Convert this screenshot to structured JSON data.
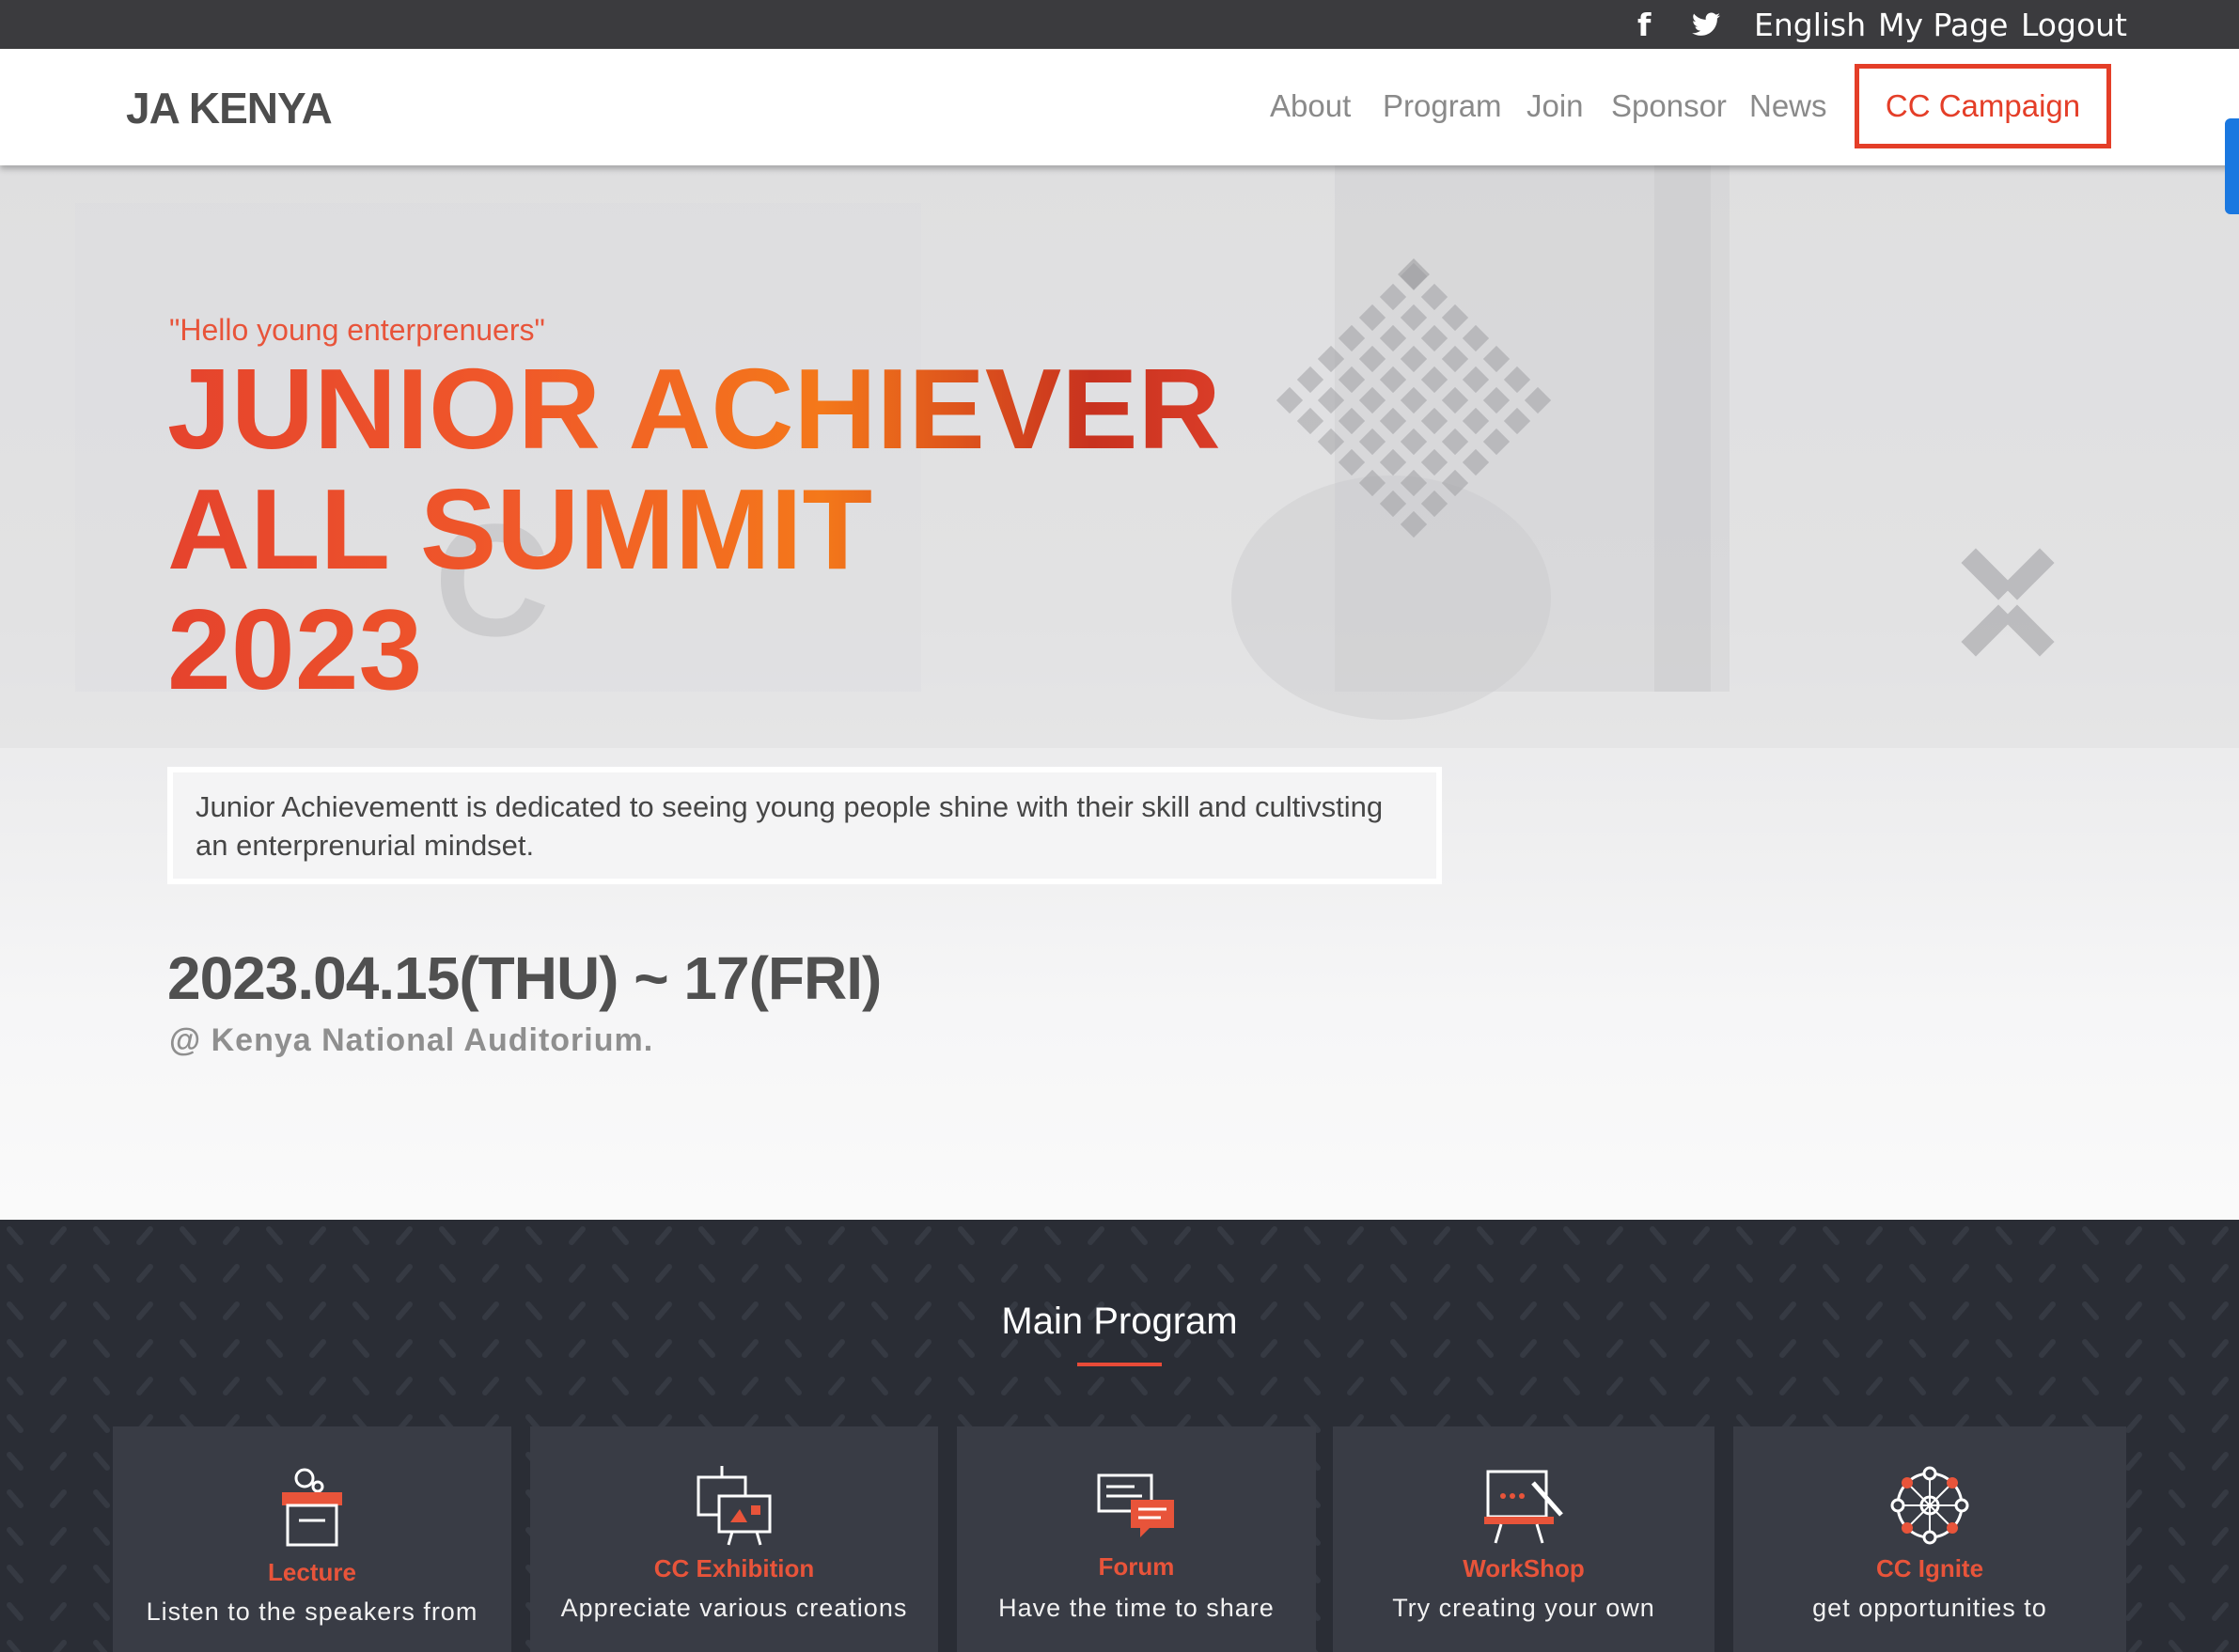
{
  "colors": {
    "accent": "#e84b38",
    "cta_border": "#e43e28",
    "topbar_bg": "#3b3b3e",
    "program_bg": "#2a2d35",
    "card_bg": "#393c45"
  },
  "topbar": {
    "facebook_glyph": "f",
    "facebook_icon": "facebook-icon",
    "twitter_icon": "twitter-icon",
    "language": "English",
    "my_page": "My Page",
    "logout": "Logout"
  },
  "nav": {
    "brand": "JA KENYA",
    "links": [
      "About",
      "Program",
      "Join",
      "Sponsor",
      "News"
    ],
    "cta": "CC Campaign"
  },
  "hero": {
    "tagline": "\"Hello young enterprenuers\"",
    "title_lines": [
      "JUNIOR ACHIEVER",
      "ALL SUMMIT",
      "2023"
    ],
    "description": "Junior Achievementt is dedicated to seeing young people shine with their skill and cultivsting an enterprenurial mindset.",
    "date": "2023.04.15(THU) ~ 17(FRI)",
    "venue": "@ Kenya National Auditorium."
  },
  "program": {
    "heading": "Main Program",
    "cards": [
      {
        "icon": "lecture-podium-icon",
        "name": "Lecture",
        "text": "Listen to the speakers from"
      },
      {
        "icon": "exhibition-board-icon",
        "name": "CC Exhibition",
        "text": "Appreciate various creations"
      },
      {
        "icon": "forum-chat-icon",
        "name": "Forum",
        "text": "Have the time to share"
      },
      {
        "icon": "workshop-easel-icon",
        "name": "WorkShop",
        "text": "Try creating your own"
      },
      {
        "icon": "network-hub-icon",
        "name": "CC Ignite",
        "text": "get opportunities to"
      }
    ]
  }
}
